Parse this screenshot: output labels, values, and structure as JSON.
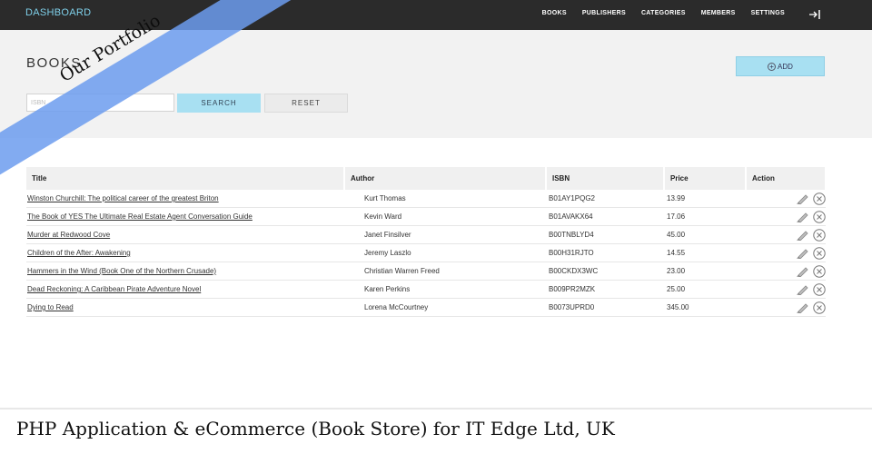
{
  "nav": {
    "brand": "DASHBOARD",
    "items": [
      "BOOKS",
      "PUBLISHERS",
      "CATEGORIES",
      "MEMBERS",
      "SETTINGS"
    ],
    "logout_icon": "logout-icon"
  },
  "header": {
    "title": "BOOKS",
    "add_label": "ADD",
    "search_placeholder": "ISBN",
    "search_label": "SEARCH",
    "reset_label": "RESET"
  },
  "ribbon": {
    "text": "Our Portfolio",
    "color": "#6c9cee"
  },
  "table": {
    "columns": [
      "Title",
      "Author",
      "ISBN",
      "Price",
      "Action"
    ],
    "rows": [
      {
        "title": "Winston Churchill: The political career of the greatest Briton",
        "author": "Kurt Thomas",
        "isbn": "B01AY1PQG2",
        "price": "13.99"
      },
      {
        "title": "The Book of YES The Ultimate Real Estate Agent Conversation Guide",
        "author": "Kevin Ward",
        "isbn": "B01AVAKX64",
        "price": "17.06"
      },
      {
        "title": "Murder at Redwood Cove",
        "author": "Janet Finsilver",
        "isbn": "B00TNBLYD4",
        "price": "45.00"
      },
      {
        "title": "Children of the After: Awakening",
        "author": "Jeremy Laszlo",
        "isbn": "B00H31RJTO",
        "price": "14.55"
      },
      {
        "title": "Hammers in the Wind (Book One of the Northern Crusade)",
        "author": "Christian Warren Freed",
        "isbn": "B00CKDX3WC",
        "price": "23.00"
      },
      {
        "title": "Dead Reckoning: A Caribbean Pirate Adventure Novel",
        "author": "Karen Perkins",
        "isbn": "B009PR2MZK",
        "price": "25.00"
      },
      {
        "title": "Dying to Read",
        "author": "Lorena McCourtney",
        "isbn": "B0073UPRD0",
        "price": "345.00"
      }
    ]
  },
  "caption": "PHP Application & eCommerce (Book Store) for IT Edge Ltd, UK",
  "colors": {
    "accent": "#a8e0f2",
    "nav_bg": "#2b2b2b",
    "brand": "#7fd0ea"
  }
}
